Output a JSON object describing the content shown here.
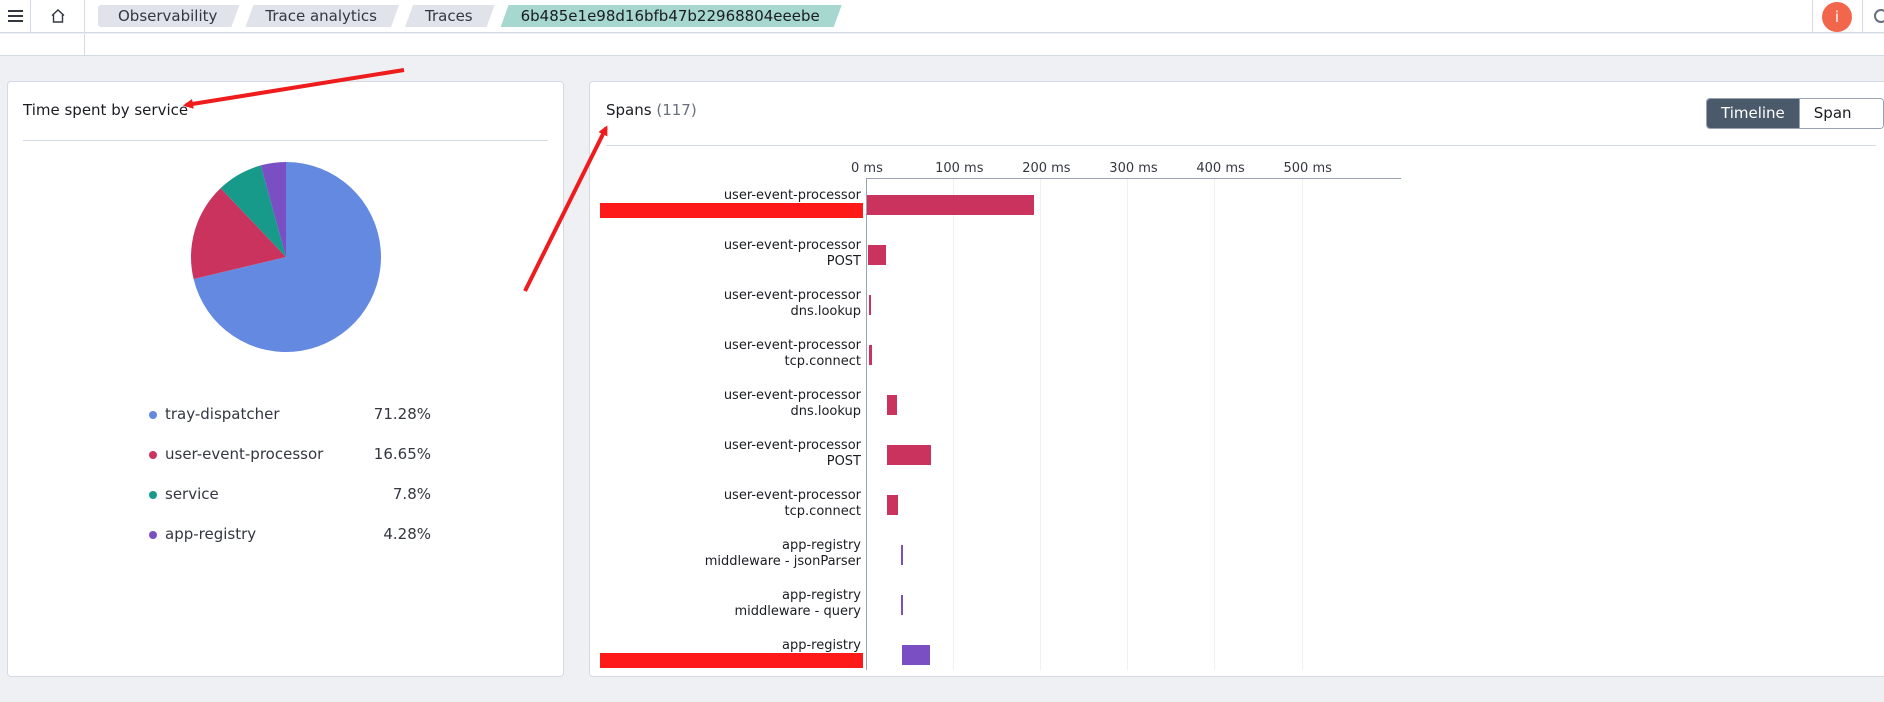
{
  "breadcrumbs": [
    "Observability",
    "Trace analytics",
    "Traces",
    "6b485e1e98d16bfb47b22968804eeebe"
  ],
  "avatar_initial": "i",
  "service_panel": {
    "title": "Time spent by service",
    "legend": [
      {
        "name": "tray-dispatcher",
        "value": "71.28%",
        "color": "#6389e0"
      },
      {
        "name": "user-event-processor",
        "value": "16.65%",
        "color": "#c9335e"
      },
      {
        "name": "service",
        "value": "7.8%",
        "color": "#179a8a"
      },
      {
        "name": "app-registry",
        "value": "4.28%",
        "color": "#7b4fc4"
      }
    ]
  },
  "chart_data": [
    {
      "type": "pie",
      "title": "",
      "categories": [
        "tray-dispatcher",
        "user-event-processor",
        "service",
        "app-registry"
      ],
      "values": [
        71.28,
        16.65,
        7.8,
        4.28
      ],
      "colors": [
        "#6389e0",
        "#c9335e",
        "#179a8a",
        "#7b4fc4"
      ]
    },
    {
      "type": "bar",
      "orientation": "horizontal-gantt",
      "xlim": [
        0,
        600
      ],
      "ticks": [
        "0 ms",
        "100 ms",
        "200 ms",
        "300 ms",
        "400 ms",
        "500 ms"
      ],
      "tick_values": [
        0,
        100,
        200,
        300,
        400,
        500
      ],
      "spans": [
        {
          "service": "user-event-processor",
          "operation": "",
          "start": 0,
          "end": 192,
          "color": "#c9335e"
        },
        {
          "service": "user-event-processor",
          "operation": "POST",
          "start": 1,
          "end": 22,
          "color": "#c9335e"
        },
        {
          "service": "user-event-processor",
          "operation": "dns.lookup",
          "start": 2,
          "end": 5,
          "color": "#c9335e"
        },
        {
          "service": "user-event-processor",
          "operation": "tcp.connect",
          "start": 2,
          "end": 6,
          "color": "#c9335e"
        },
        {
          "service": "user-event-processor",
          "operation": "dns.lookup",
          "start": 23,
          "end": 35,
          "color": "#c9335e"
        },
        {
          "service": "user-event-processor",
          "operation": "POST",
          "start": 23,
          "end": 73,
          "color": "#c9335e"
        },
        {
          "service": "user-event-processor",
          "operation": "tcp.connect",
          "start": 23,
          "end": 36,
          "color": "#c9335e"
        },
        {
          "service": "app-registry",
          "operation": "middleware - jsonParser",
          "start": 39,
          "end": 40.5,
          "color": "#7b4fc4"
        },
        {
          "service": "app-registry",
          "operation": "middleware - query",
          "start": 39,
          "end": 40.5,
          "color": "#7b4fc4"
        },
        {
          "service": "app-registry",
          "operation": "",
          "start": 40,
          "end": 72,
          "color": "#7b4fc4"
        }
      ]
    }
  ],
  "spans_panel": {
    "title": "Spans",
    "count": "(117)",
    "toggle": {
      "timeline": "Timeline",
      "span_list": "Span list"
    }
  }
}
